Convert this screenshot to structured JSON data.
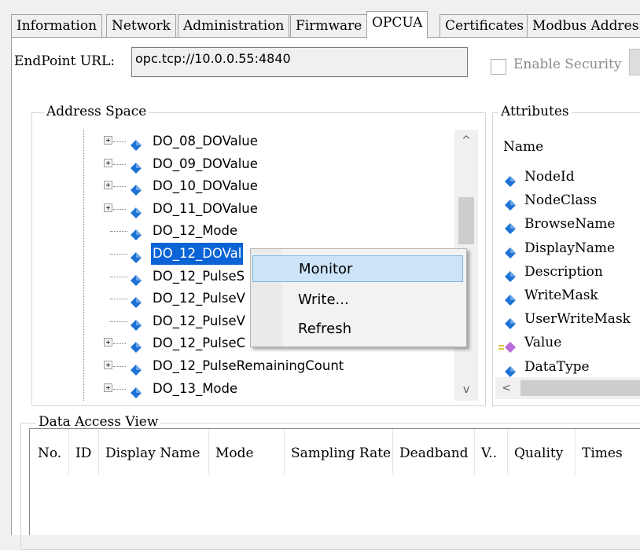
{
  "tabs": [
    "Information",
    "Network",
    "Administration",
    "Firmware",
    "OPCUA",
    "Certificates",
    "Modbus Addres"
  ],
  "active_tab": "OPCUA",
  "endpoint": {
    "label": "EndPoint URL:",
    "value": "opc.tcp://10.0.0.55:4840"
  },
  "security": {
    "label": "Enable Security",
    "checked": false
  },
  "address_space": {
    "title": "Address Space",
    "nodes": [
      {
        "label": "DO_08_DOValue",
        "expandable": true
      },
      {
        "label": "DO_09_DOValue",
        "expandable": true
      },
      {
        "label": "DO_10_DOValue",
        "expandable": true
      },
      {
        "label": "DO_11_DOValue",
        "expandable": true
      },
      {
        "label": "DO_12_Mode",
        "expandable": false
      },
      {
        "label": "DO_12_DOValue",
        "expandable": false,
        "selected": true
      },
      {
        "label": "DO_12_PulseS",
        "expandable": false
      },
      {
        "label": "DO_12_PulseV",
        "expandable": false
      },
      {
        "label": "DO_12_PulseV",
        "expandable": false
      },
      {
        "label": "DO_12_PulseC",
        "expandable": true
      },
      {
        "label": "DO_12_PulseRemainingCount",
        "expandable": true
      },
      {
        "label": "DO_13_Mode",
        "expandable": true
      }
    ],
    "selected_visible_text": "DO_12_DOVal",
    "scroll_up": "^",
    "scroll_down": "v"
  },
  "context_menu": {
    "items": [
      {
        "label": "Monitor",
        "highlighted": true
      },
      {
        "label": "Write...",
        "highlighted": false
      },
      {
        "label": "Refresh",
        "highlighted": false
      }
    ]
  },
  "attributes": {
    "title": "Attributes",
    "header": "Name",
    "items": [
      {
        "label": "NodeId",
        "icon": "node-diamond-icon"
      },
      {
        "label": "NodeClass",
        "icon": "node-diamond-icon"
      },
      {
        "label": "BrowseName",
        "icon": "node-diamond-icon"
      },
      {
        "label": "DisplayName",
        "icon": "node-diamond-icon"
      },
      {
        "label": "Description",
        "icon": "node-diamond-icon"
      },
      {
        "label": "WriteMask",
        "icon": "node-diamond-icon"
      },
      {
        "label": "UserWriteMask",
        "icon": "node-diamond-icon"
      },
      {
        "label": "Value",
        "icon": "value-property-icon"
      },
      {
        "label": "DataType",
        "icon": "node-diamond-icon"
      }
    ],
    "scroll_left": "<"
  },
  "data_access_view": {
    "title": "Data Access View",
    "columns": [
      "No.",
      "ID",
      "Display Name",
      "Mode",
      "Sampling Rate",
      "Deadband",
      "V..",
      "Quality",
      "Times"
    ]
  },
  "colors": {
    "selection": "#0b64d6",
    "menu_highlight": "#cce4f7",
    "node_icon": "#1d72d6",
    "value_icon": "#b86ad8"
  }
}
